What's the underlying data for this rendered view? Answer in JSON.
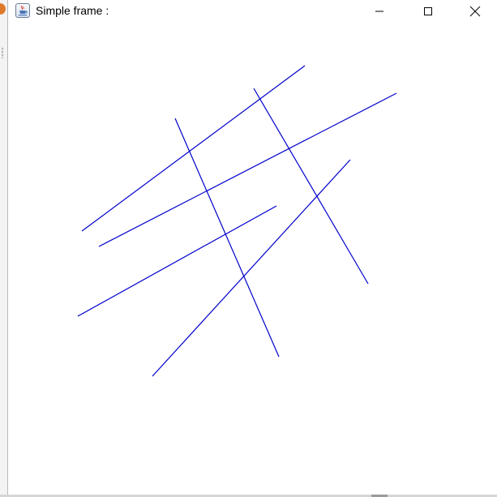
{
  "window": {
    "title": "Simple frame :",
    "app_icon": "java-cup-icon",
    "controls": {
      "minimize_icon": "minimize-icon",
      "maximize_icon": "maximize-icon",
      "close_icon": "close-icon"
    }
  },
  "drawing": {
    "line_color": "#0000cc",
    "line_count": 6
  }
}
